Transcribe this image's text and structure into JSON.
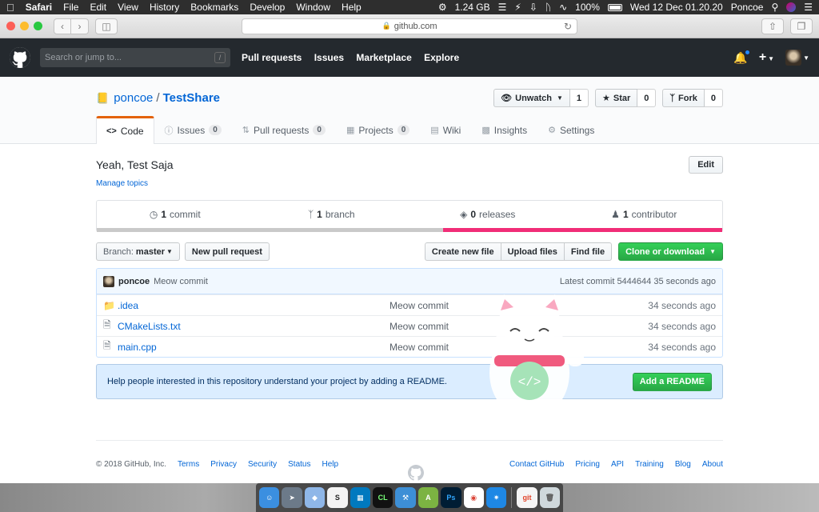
{
  "menubar": {
    "app": "Safari",
    "items": [
      "File",
      "Edit",
      "View",
      "History",
      "Bookmarks",
      "Develop",
      "Window",
      "Help"
    ],
    "memory": "1.24 GB",
    "battery": "100%",
    "datetime": "Wed 12 Dec  01.20.20",
    "user": "Poncoe"
  },
  "safari": {
    "url": "github.com"
  },
  "gh": {
    "search_placeholder": "Search or jump to...",
    "search_hint": "/",
    "nav": [
      "Pull requests",
      "Issues",
      "Marketplace",
      "Explore"
    ]
  },
  "repo": {
    "owner": "poncoe",
    "separator": "/",
    "name": "TestShare",
    "watch_label": "Unwatch",
    "watch_count": "1",
    "star_label": "Star",
    "star_count": "0",
    "fork_label": "Fork",
    "fork_count": "0",
    "tabs": [
      {
        "label": "Code"
      },
      {
        "label": "Issues",
        "count": "0"
      },
      {
        "label": "Pull requests",
        "count": "0"
      },
      {
        "label": "Projects",
        "count": "0"
      },
      {
        "label": "Wiki"
      },
      {
        "label": "Insights"
      },
      {
        "label": "Settings"
      }
    ],
    "description": "Yeah, Test Saja",
    "edit_label": "Edit",
    "manage_topics": "Manage topics",
    "summary": {
      "commits_num": "1",
      "commits_label": "commit",
      "branches_num": "1",
      "branches_label": "branch",
      "releases_num": "0",
      "releases_label": "releases",
      "contributors_num": "1",
      "contributors_label": "contributor"
    },
    "branch_label": "Branch:",
    "branch_name": "master",
    "new_pr": "New pull request",
    "create_file": "Create new file",
    "upload_files": "Upload files",
    "find_file": "Find file",
    "clone": "Clone or download",
    "commit_author": "poncoe",
    "commit_message": "Meow commit",
    "latest_commit_label": "Latest commit",
    "latest_commit_sha": "5444644",
    "latest_commit_age": "35 seconds ago",
    "files": [
      {
        "name": ".idea",
        "type": "folder",
        "message": "Meow commit",
        "age": "34 seconds ago"
      },
      {
        "name": "CMakeLists.txt",
        "type": "file",
        "message": "Meow commit",
        "age": "34 seconds ago"
      },
      {
        "name": "main.cpp",
        "type": "file",
        "message": "Meow commit",
        "age": "34 seconds ago"
      }
    ],
    "readme_prompt": "Help people interested in this repository understand your project by adding a README.",
    "add_readme": "Add a README"
  },
  "footer": {
    "copyright": "© 2018 GitHub, Inc.",
    "left_links": [
      "Terms",
      "Privacy",
      "Security",
      "Status",
      "Help"
    ],
    "right_links": [
      "Contact GitHub",
      "Pricing",
      "API",
      "Training",
      "Blog",
      "About"
    ]
  },
  "colors": {
    "header_bg": "#24292e",
    "link": "#0366d6",
    "primary_green": "#28a745",
    "tab_accent": "#e36209",
    "lang_pink": "#f12d77"
  }
}
